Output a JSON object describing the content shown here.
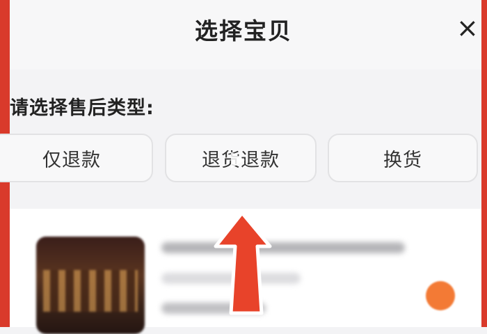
{
  "header": {
    "title": "选择宝贝",
    "close_glyph": "×"
  },
  "after_sale": {
    "label": "请选择售后类型:",
    "options": [
      {
        "label": "仅退款"
      },
      {
        "label": "退货退款"
      },
      {
        "label": "换货"
      }
    ]
  },
  "colors": {
    "frame_red": "#d93a2b",
    "arrow_red": "#e8432a",
    "badge_orange": "#f37a35"
  },
  "icons": [
    "close-icon",
    "play-icon",
    "up-arrow-annotation"
  ]
}
